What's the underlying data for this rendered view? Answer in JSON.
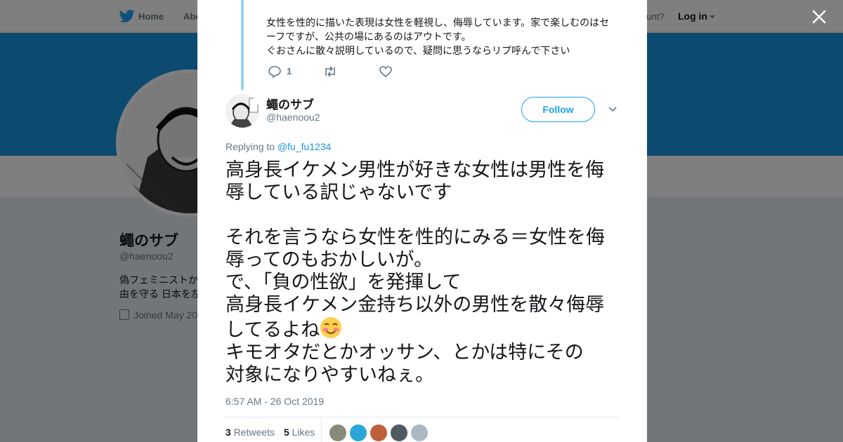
{
  "background": {
    "nav": {
      "home_label": "Home",
      "about_label": "Abo",
      "have_account": "ccount?",
      "login_label": "Log in"
    },
    "profile": {
      "name": "蠅のサブ",
      "handle": "@haenoou2",
      "bio_line1": "偽フェミニストか",
      "bio_line2": "由を守る 日本を左",
      "joined": "Joined May 20"
    }
  },
  "parent_tweet": {
    "lines": [
      "女性を性的に描いた表現は女性を軽視し、侮辱しています。家で楽しむのはセ",
      "ーフですが、公共の場にあるのはアウトです。",
      "ぐおさんに散々説明しているので、疑問に思うならリプ呼んで下さい"
    ],
    "reply_count": "1"
  },
  "tweet": {
    "author_name": "蠅のサブ",
    "author_handle": "@haenoou2",
    "follow_label": "Follow",
    "replying_prefix": "Replying to",
    "replying_to": "@fu_fu1234",
    "lines": [
      "高身長イケメン男性が好きな女性は男性を侮",
      "辱している訳じゃないです",
      "",
      "それを言うなら女性を性的にみる＝女性を侮",
      "辱ってのもおかしいが。",
      "で、「負の性欲」を発揮して",
      "高身長イケメン金持ち以外の男性を散々侮辱",
      "してるよね",
      "キモオタだとかオッサン、とかは特にその",
      "対象になりやすいねぇ。"
    ],
    "emoji": "smiling-face-with-blush",
    "timestamp": "6:57 AM - 26 Oct 2019",
    "retweets_count": "3",
    "retweets_label": "Retweets",
    "likes_count": "5",
    "likes_label": "Likes"
  },
  "colors": {
    "twitter_blue": "#1da1f2",
    "banner": "#1b95e0",
    "thread_line": "#9ad0ef",
    "liker_avatars": [
      "#8a8a7a",
      "#2aa7d8",
      "#c0603a",
      "#505a60",
      "#aab8c2"
    ]
  },
  "icons": [
    "bird-icon",
    "close-icon",
    "reply-icon",
    "retweet-icon",
    "like-icon",
    "chevron-down-icon",
    "calendar-icon"
  ]
}
